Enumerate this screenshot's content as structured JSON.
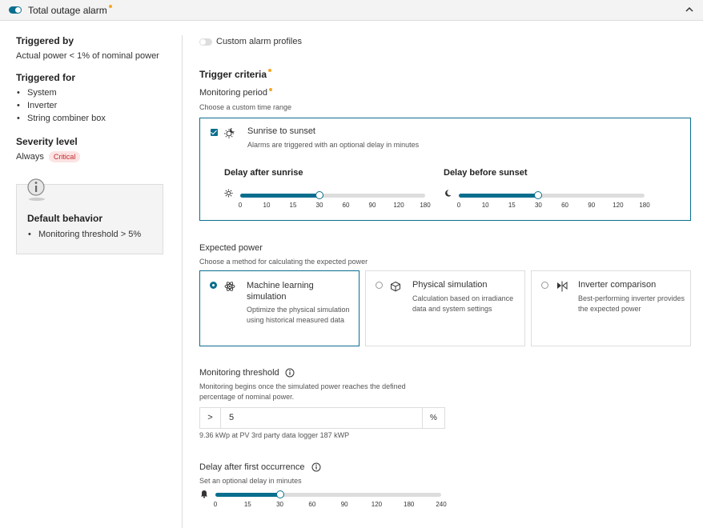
{
  "header": {
    "title": "Total outage alarm"
  },
  "left": {
    "triggered_by": {
      "title": "Triggered by",
      "value": "Actual power < 1% of nominal power"
    },
    "triggered_for": {
      "title": "Triggered for",
      "items": [
        "System",
        "Inverter",
        "String combiner box"
      ]
    },
    "severity": {
      "title": "Severity level",
      "value": "Always",
      "badge": "Critical"
    },
    "default_behavior": {
      "title": "Default behavior",
      "items": [
        "Monitoring threshold > 5%"
      ]
    }
  },
  "custom_profiles": {
    "label": "Custom alarm profiles"
  },
  "trigger_criteria": {
    "title": "Trigger criteria",
    "monitoring_period": {
      "title": "Monitoring period",
      "hint": "Choose a custom time range"
    },
    "sunrise_option": {
      "title": "Sunrise to sunset",
      "desc": "Alarms are triggered with an optional delay in minutes"
    },
    "delay_sunrise": {
      "label": "Delay after sunrise",
      "ticks": [
        "0",
        "10",
        "15",
        "30",
        "60",
        "90",
        "120",
        "180"
      ],
      "value": 30
    },
    "delay_sunset": {
      "label": "Delay before sunset",
      "ticks": [
        "0",
        "10",
        "15",
        "30",
        "60",
        "90",
        "120",
        "180"
      ],
      "value": 30
    }
  },
  "expected_power": {
    "title": "Expected power",
    "hint": "Choose a method for calculating the expected power",
    "options": [
      {
        "title": "Machine learning simulation",
        "desc": "Optimize the physical simulation using historical measured data"
      },
      {
        "title": "Physical simulation",
        "desc": "Calculation based on irradiance data and system settings"
      },
      {
        "title": "Inverter comparison",
        "desc": "Best-performing inverter provides the expected power"
      }
    ]
  },
  "threshold": {
    "title": "Monitoring threshold",
    "desc": "Monitoring begins once the simulated power reaches the defined percentage of nominal power.",
    "prefix": ">",
    "value": "5",
    "suffix": "%",
    "note": "9.36 kWp at PV 3rd party data logger 187 kWP"
  },
  "first_occurrence": {
    "title": "Delay after first occurrence",
    "hint": "Set an optional delay in minutes",
    "ticks": [
      "0",
      "15",
      "30",
      "60",
      "90",
      "120",
      "180",
      "240"
    ],
    "value": 30
  },
  "colors": {
    "accent": "#0a6e8e",
    "required_dot": "#f5a623",
    "critical_bg": "#fde3e3",
    "critical_text": "#c0282a"
  }
}
